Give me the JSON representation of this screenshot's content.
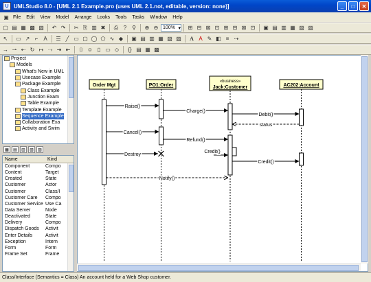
{
  "window": {
    "title": "UMLStudio 8.0 - [UML 2.1 Example.pro (uses UML 2.1.not, editable, version: none)]"
  },
  "menu": [
    "File",
    "Edit",
    "View",
    "Model",
    "Arrange",
    "Looks",
    "Tools",
    "Tasks",
    "Window",
    "Help"
  ],
  "toolbar": {
    "zoom": "100%"
  },
  "tree": {
    "items": [
      {
        "label": "Project",
        "indent": 0
      },
      {
        "label": "Models",
        "indent": 1
      },
      {
        "label": "What's New in UML",
        "indent": 2
      },
      {
        "label": "Usecase Example",
        "indent": 2
      },
      {
        "label": "Package Example",
        "indent": 2
      },
      {
        "label": "Class Example",
        "indent": 3
      },
      {
        "label": "Junction Exam",
        "indent": 3
      },
      {
        "label": "Table Example",
        "indent": 3
      },
      {
        "label": "Template Example",
        "indent": 2
      },
      {
        "label": "Sequence Example",
        "indent": 2,
        "selected": true
      },
      {
        "label": "Collaboration Exa",
        "indent": 2
      },
      {
        "label": "Activity and Swim",
        "indent": 2
      }
    ]
  },
  "props": {
    "header": {
      "name": "Name",
      "kind": "Kind"
    },
    "rows": [
      [
        "Component",
        "Compo"
      ],
      [
        "Content",
        "Target"
      ],
      [
        "Created",
        "State"
      ],
      [
        "Customer",
        "Actor"
      ],
      [
        "Customer",
        "Class/I"
      ],
      [
        "Customer Care",
        "Compo"
      ],
      [
        "Customer Service",
        "Use Ca"
      ],
      [
        "Data Server",
        "Node"
      ],
      [
        "Deactivated",
        "State"
      ],
      [
        "Delivery",
        "Compo"
      ],
      [
        "Dispatch Goods",
        "Activit"
      ],
      [
        "Enter Details",
        "Activit"
      ],
      [
        "Exception",
        "Intern"
      ],
      [
        "Form",
        "Form"
      ],
      [
        "Frame Set",
        "Frame"
      ]
    ]
  },
  "diagram": {
    "lifelines": [
      {
        "id": "om",
        "label": "Order Mgt",
        "stereotype": ""
      },
      {
        "id": "po",
        "label": "PO1:Order",
        "stereotype": ""
      },
      {
        "id": "jc",
        "label": "Jack:Customer",
        "stereotype": "«business»"
      },
      {
        "id": "ac",
        "label": "AC202:Account",
        "stereotype": ""
      }
    ],
    "messages": [
      "Raise()",
      "Charge()",
      "Debit()",
      "status",
      "Cancel()",
      "Refund()",
      "Credit()",
      "Credit()",
      "Destroy",
      "Notify()"
    ]
  },
  "status": "Class/Interface (Semantics = Class) An account held for a Web Shop customer."
}
